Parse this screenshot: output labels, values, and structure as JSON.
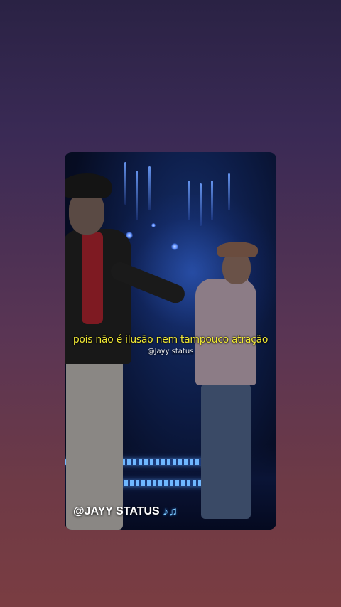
{
  "video": {
    "lyric_line": "pois não é ilusão nem tampouco atração",
    "lyric_credit": "@Jayy status",
    "watermark_text": "@JAYY STATUS",
    "watermark_icon": "music-notes-icon"
  },
  "colors": {
    "lyric": "#f0e835",
    "background_top": "#2a2244",
    "background_bottom": "#7a3d42"
  }
}
